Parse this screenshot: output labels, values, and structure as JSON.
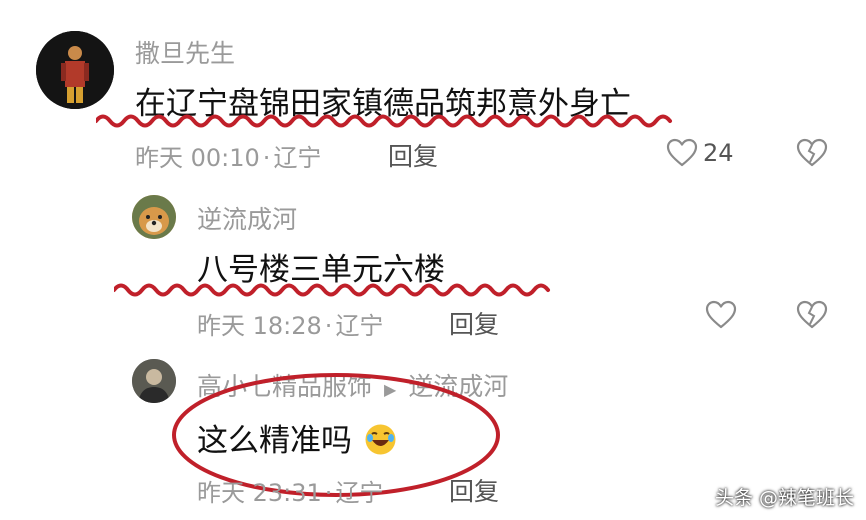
{
  "comments": [
    {
      "username": "撒旦先生",
      "text": "在辽宁盘锦田家镇德品筑邦意外身亡",
      "time": "昨天 00:10",
      "location": "辽宁",
      "reply_label": "回复",
      "likes": "24"
    },
    {
      "username": "逆流成河",
      "text": "八号楼三单元六楼",
      "time": "昨天 18:28",
      "location": "辽宁",
      "reply_label": "回复"
    },
    {
      "username": "高小七精品服饰",
      "reply_to": "逆流成河",
      "text": "这么精准吗",
      "time": "昨天 23:31",
      "location": "辽宁",
      "reply_label": "回复"
    }
  ],
  "separator": "·",
  "watermark": "头条 @辣笔班长",
  "colors": {
    "annotation_red": "#c0202a",
    "meta_gray": "#9a9a9a"
  },
  "icons": [
    "heart-icon",
    "dislike-heart-icon",
    "laughing-emoji-icon",
    "reply-arrow-icon"
  ]
}
